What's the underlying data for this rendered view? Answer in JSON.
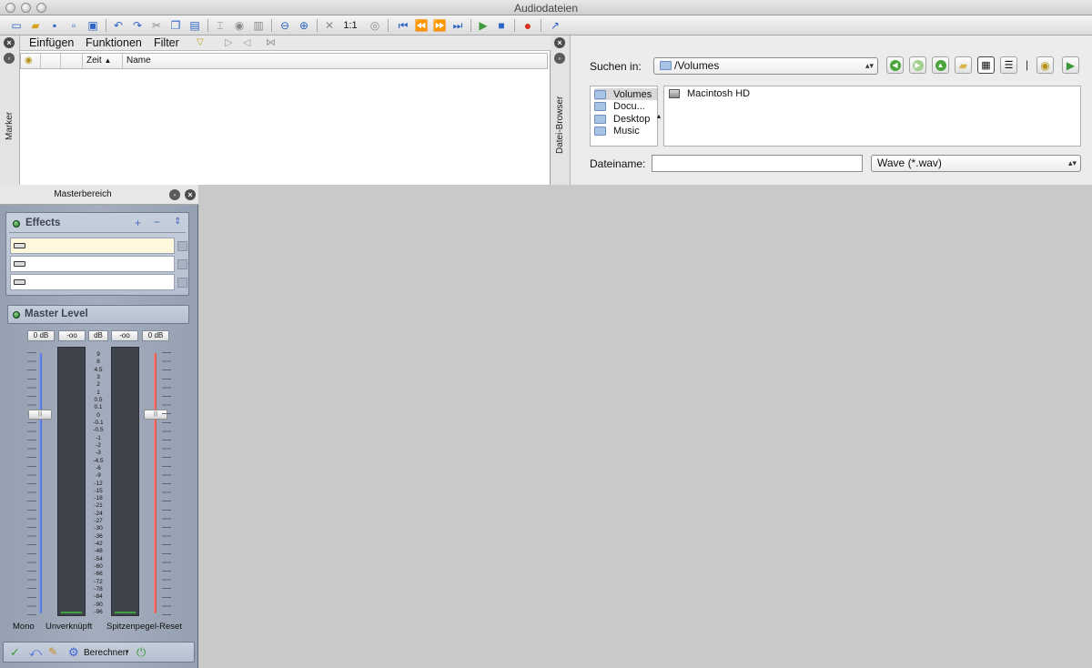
{
  "window": {
    "title": "Audiodateien"
  },
  "toolbar": {
    "zoom_label": "1:1"
  },
  "marker_panel": {
    "side_label": "Marker",
    "menu": [
      "Einfügen",
      "Funktionen",
      "Filter"
    ],
    "columns": [
      "Zeit",
      "Name"
    ]
  },
  "browser_panel": {
    "side_label": "Datei-Browser",
    "search_label": "Suchen in:",
    "search_path": "/Volumes",
    "locations": [
      "Volumes",
      "Docu...",
      "Desktop",
      "Music"
    ],
    "files": [
      "Macintosh HD"
    ],
    "filename_label": "Dateiname:",
    "filename_value": "",
    "filetype_value": "Wave (*.wav)",
    "list_separator": "|"
  },
  "master": {
    "title": "Masterbereich",
    "effects_title": "Effects",
    "level_title": "Master Level",
    "readouts": [
      "0 dB",
      "-oo",
      "dB",
      "-oo",
      "0 dB"
    ],
    "scale": [
      "9",
      "6",
      "4.5",
      "3",
      "2",
      "1",
      "0.5",
      "0.1",
      "0",
      "-0.1",
      "-0.5",
      "-1",
      "-2",
      "-3",
      "-4.5",
      "-6",
      "-9",
      "-12",
      "-15",
      "-18",
      "-21",
      "-24",
      "-27",
      "-30",
      "-36",
      "-42",
      "-48",
      "-54",
      "-60",
      "-66",
      "-72",
      "-78",
      "-84",
      "-90",
      "-96"
    ],
    "labels": {
      "mono": "Mono",
      "unlinked": "Unverknüpft",
      "peak_reset": "Spitzenpegel-Reset"
    },
    "bottom": {
      "calculate_label": "Berechnen"
    }
  },
  "colors": {
    "fader_left": "#3f66d8",
    "fader_right": "#d84b3c",
    "record": "#d9321f"
  }
}
